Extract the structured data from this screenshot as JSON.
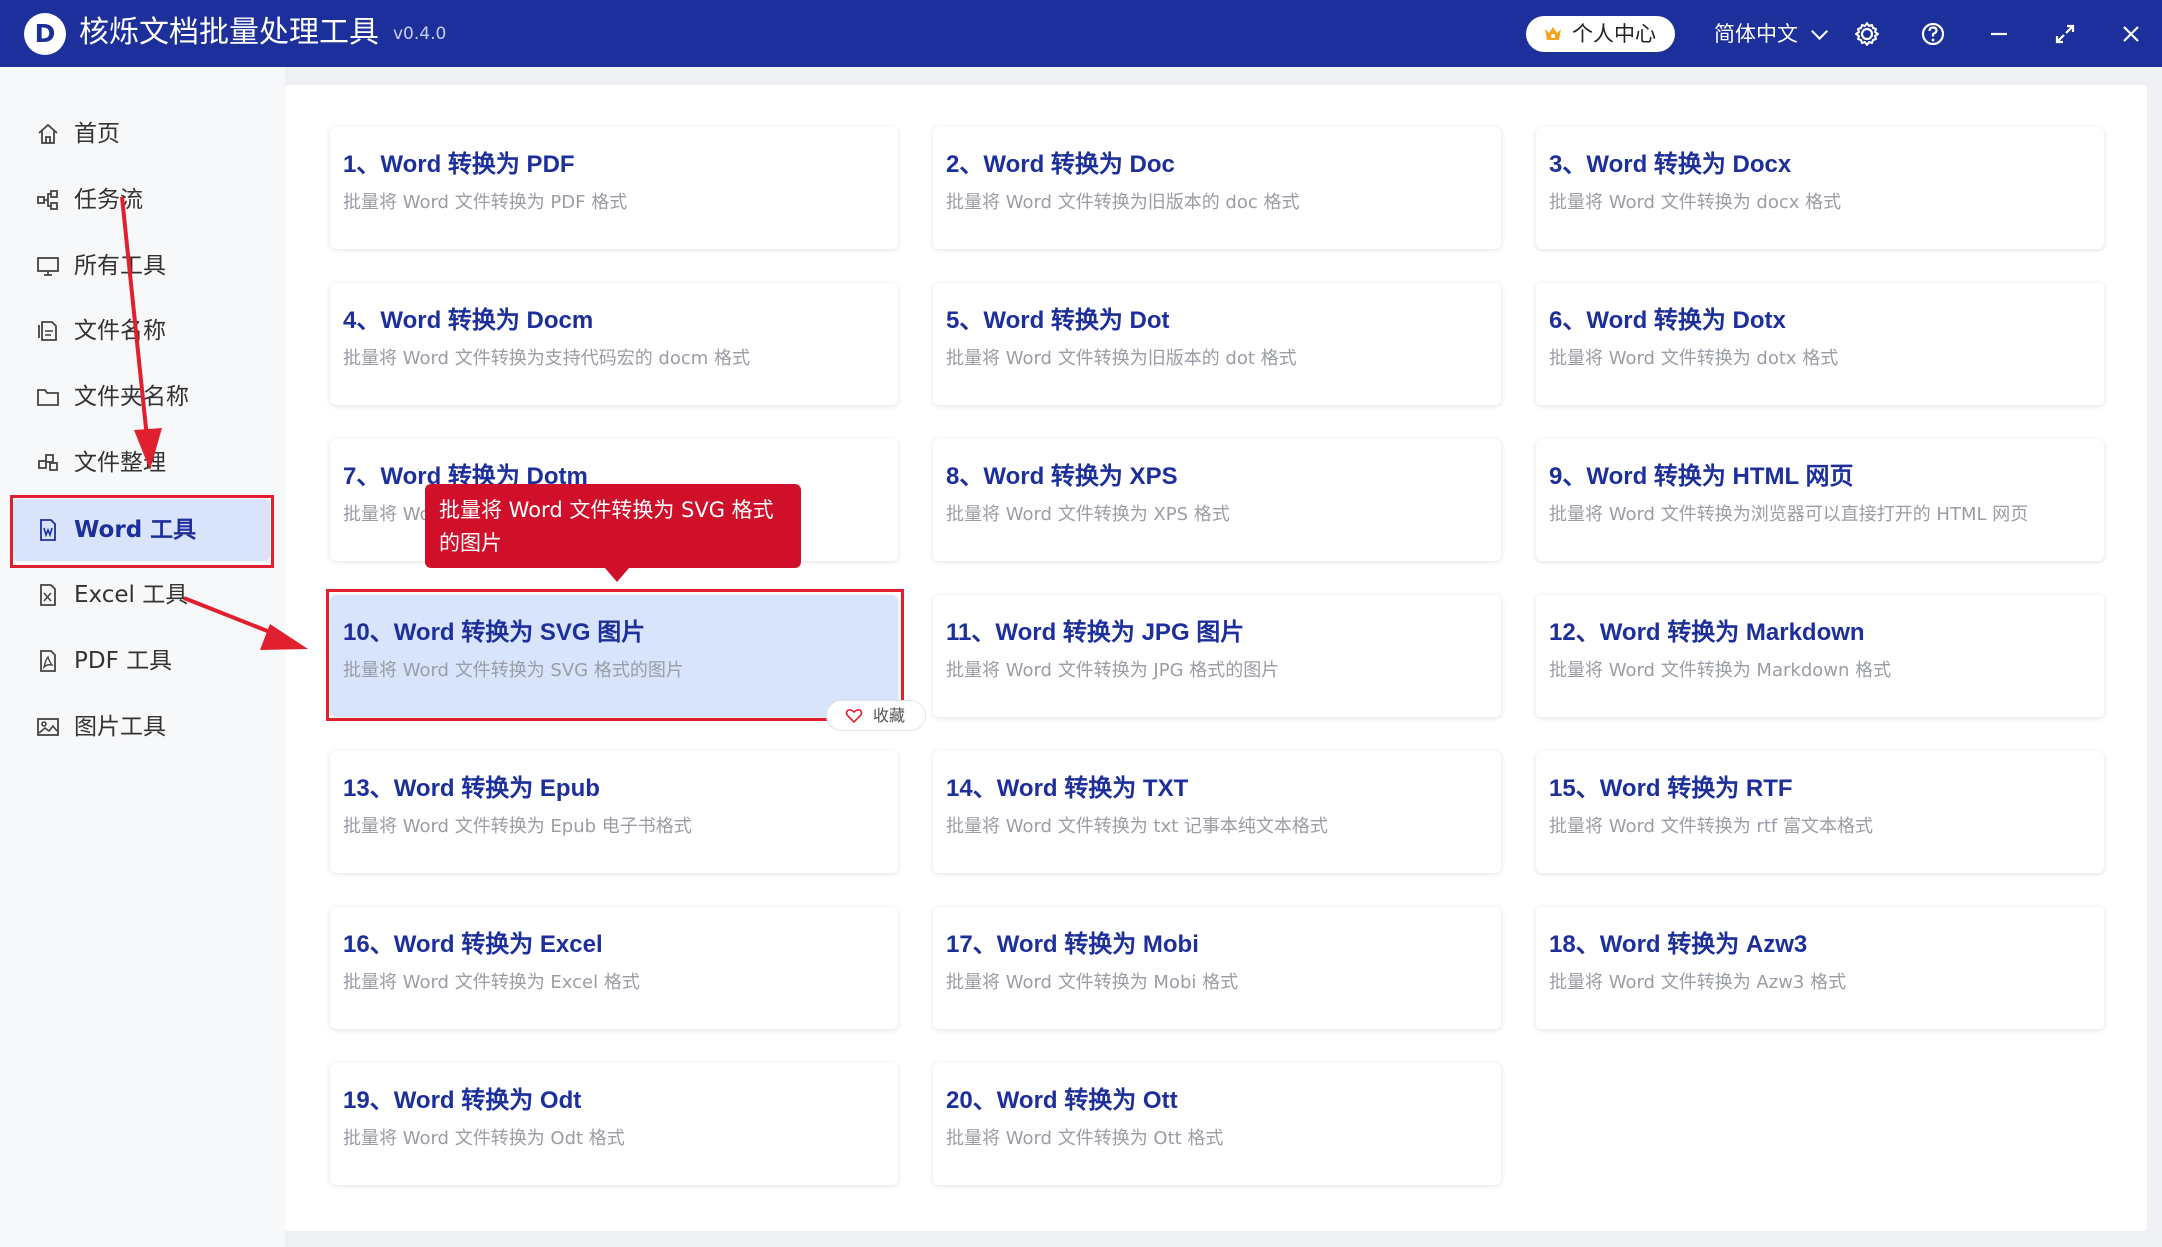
{
  "app": {
    "title": "核烁文档批量处理工具",
    "version": "v0.4.0",
    "logo_letter": "D",
    "user_center": "个人中心",
    "language": "简体中文",
    "icons": [
      "crown-icon",
      "chevron-down-icon",
      "gear-icon",
      "help-icon",
      "minimize-icon",
      "maximize-icon",
      "close-icon"
    ]
  },
  "sidebar": {
    "items": [
      {
        "label": "首页",
        "icon": "home-icon"
      },
      {
        "label": "任务流",
        "icon": "workflow-icon"
      },
      {
        "label": "所有工具",
        "icon": "monitor-icon"
      },
      {
        "label": "文件名称",
        "icon": "file-name-icon"
      },
      {
        "label": "文件夹名称",
        "icon": "folder-icon"
      },
      {
        "label": "文件整理",
        "icon": "organize-icon"
      },
      {
        "label": "Word 工具",
        "icon": "word-file-icon",
        "active": true
      },
      {
        "label": "Excel 工具",
        "icon": "excel-file-icon"
      },
      {
        "label": "PDF 工具",
        "icon": "pdf-file-icon"
      },
      {
        "label": "图片工具",
        "icon": "image-icon"
      }
    ]
  },
  "cards": [
    {
      "title": "1、Word 转换为 PDF",
      "desc": "批量将 Word 文件转换为 PDF 格式"
    },
    {
      "title": "2、Word 转换为 Doc",
      "desc": "批量将 Word 文件转换为旧版本的 doc 格式"
    },
    {
      "title": "3、Word 转换为 Docx",
      "desc": "批量将 Word 文件转换为 docx 格式"
    },
    {
      "title": "4、Word 转换为 Docm",
      "desc": "批量将 Word 文件转换为支持代码宏的 docm 格式"
    },
    {
      "title": "5、Word 转换为 Dot",
      "desc": "批量将 Word 文件转换为旧版本的 dot 格式"
    },
    {
      "title": "6、Word 转换为 Dotx",
      "desc": "批量将 Word 文件转换为 dotx 格式"
    },
    {
      "title": "7、Word 转换为 Dotm",
      "desc": "批量将 Word 文件转换为 dotm 格式"
    },
    {
      "title": "8、Word 转换为 XPS",
      "desc": "批量将 Word 文件转换为 XPS 格式"
    },
    {
      "title": "9、Word 转换为 HTML 网页",
      "desc": "批量将 Word 文件转换为浏览器可以直接打开的 HTML 网页"
    },
    {
      "title": "10、Word 转换为 SVG 图片",
      "desc": "批量将 Word 文件转换为 SVG 格式的图片",
      "selected": true
    },
    {
      "title": "11、Word 转换为 JPG 图片",
      "desc": "批量将 Word 文件转换为 JPG 格式的图片"
    },
    {
      "title": "12、Word 转换为 Markdown",
      "desc": "批量将 Word 文件转换为 Markdown 格式"
    },
    {
      "title": "13、Word 转换为 Epub",
      "desc": "批量将 Word 文件转换为 Epub 电子书格式"
    },
    {
      "title": "14、Word 转换为 TXT",
      "desc": "批量将 Word 文件转换为 txt 记事本纯文本格式"
    },
    {
      "title": "15、Word 转换为 RTF",
      "desc": "批量将 Word 文件转换为 rtf 富文本格式"
    },
    {
      "title": "16、Word 转换为 Excel",
      "desc": "批量将 Word 文件转换为 Excel 格式"
    },
    {
      "title": "17、Word 转换为 Mobi",
      "desc": "批量将 Word 文件转换为 Mobi 格式"
    },
    {
      "title": "18、Word 转换为 Azw3",
      "desc": "批量将 Word 文件转换为 Azw3 格式"
    },
    {
      "title": "19、Word 转换为 Odt",
      "desc": "批量将 Word 文件转换为 Odt 格式"
    },
    {
      "title": "20、Word 转换为 Ott",
      "desc": "批量将 Word 文件转换为 Ott 格式"
    }
  ],
  "tooltip": "批量将 Word 文件转换为 SVG 格式的图片",
  "favorite_label": "收藏",
  "colors": {
    "brand": "#1d2f9b",
    "highlight": "#e0202e",
    "selected_card": "#d8e4fb"
  }
}
